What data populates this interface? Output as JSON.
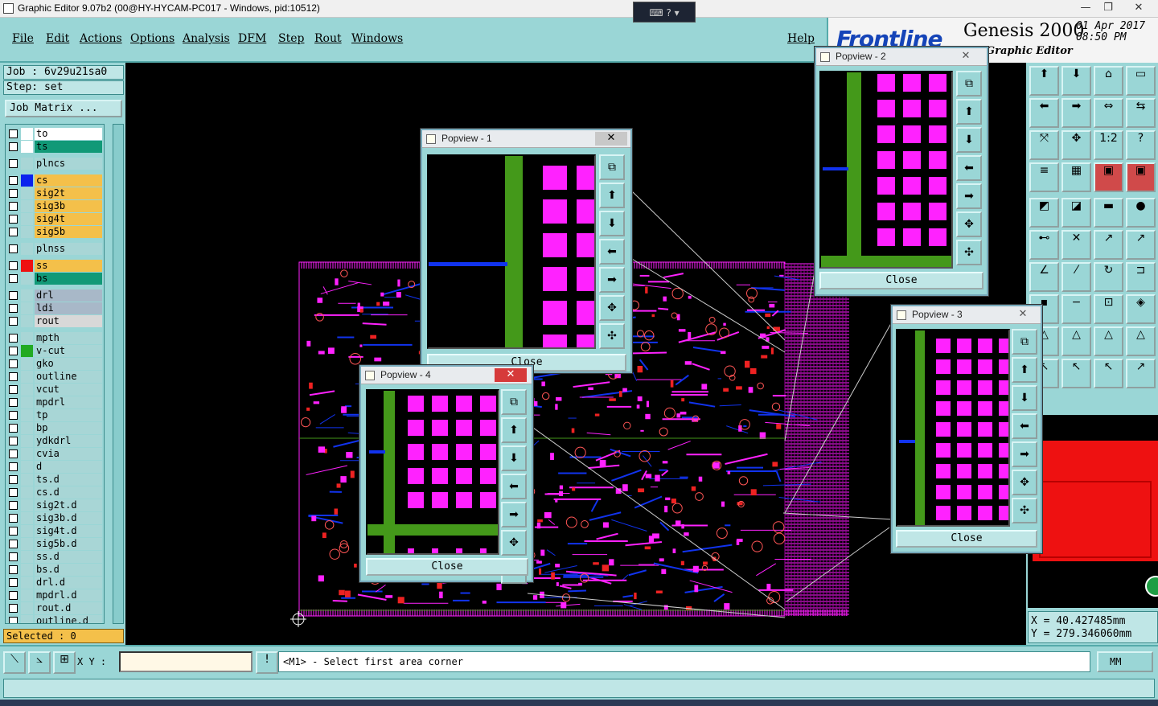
{
  "window": {
    "title": "Graphic Editor 9.07b2 (00@HY-HYCAM-PC017 - Windows, pid:10512)",
    "min": "—",
    "max": "❐",
    "close": "✕"
  },
  "ime": "⌨ ? ▾",
  "menu": [
    "File",
    "Edit",
    "Actions",
    "Options",
    "Analysis",
    "DFM",
    "Step",
    "Rout",
    "Windows"
  ],
  "help": "Help",
  "logo": {
    "brand": "Frontline",
    "product": "Genesis 2000",
    "sub": "Graphic Editor",
    "date": "01 Apr 2017",
    "time": "08:50 PM"
  },
  "job": "Job : 6v29u21sa0",
  "step": "Step: set",
  "job_matrix": "Job Matrix ...",
  "layers": [
    {
      "name": "to",
      "color": "#ffffff",
      "swatch": "#ffffff"
    },
    {
      "name": "ts",
      "color": "#119977",
      "swatch": "#ffffff"
    },
    {
      "name": "plncs",
      "color": "#a8d6d6",
      "swatch": "#a8d6d6"
    },
    {
      "name": "cs",
      "color": "#f4c04a",
      "swatch": "#0a22ee"
    },
    {
      "name": "sig2t",
      "color": "#f4c04a",
      "swatch": "#a8d6d6"
    },
    {
      "name": "sig3b",
      "color": "#f4c04a",
      "swatch": "#a8d6d6"
    },
    {
      "name": "sig4t",
      "color": "#f4c04a",
      "swatch": "#a8d6d6"
    },
    {
      "name": "sig5b",
      "color": "#f4c04a",
      "swatch": "#a8d6d6"
    },
    {
      "name": "plnss",
      "color": "#a8d6d6",
      "swatch": "#a8d6d6"
    },
    {
      "name": "ss",
      "color": "#f4c04a",
      "swatch": "#ee1111"
    },
    {
      "name": "bs",
      "color": "#119977",
      "swatch": "#a8d6d6"
    },
    {
      "name": "drl",
      "color": "#a8b8c8",
      "swatch": "#a8d6d6"
    },
    {
      "name": "ldi",
      "color": "#a8b8c8",
      "swatch": "#a8d6d6"
    },
    {
      "name": "rout",
      "color": "#d8d8d8",
      "swatch": "#a8d6d6"
    },
    {
      "name": "mpth",
      "color": "#a8d6d6",
      "swatch": "#a8d6d6"
    },
    {
      "name": "v-cut",
      "color": "#a8d6d6",
      "swatch": "#22aa22"
    },
    {
      "name": "gko",
      "color": "#a8d6d6",
      "swatch": "#a8d6d6"
    },
    {
      "name": "outline",
      "color": "#a8d6d6",
      "swatch": "#a8d6d6"
    },
    {
      "name": "vcut",
      "color": "#a8d6d6",
      "swatch": "#a8d6d6"
    },
    {
      "name": "mpdrl",
      "color": "#a8d6d6",
      "swatch": "#a8d6d6"
    },
    {
      "name": "tp",
      "color": "#a8d6d6",
      "swatch": "#a8d6d6"
    },
    {
      "name": "bp",
      "color": "#a8d6d6",
      "swatch": "#a8d6d6"
    },
    {
      "name": "ydkdrl",
      "color": "#a8d6d6",
      "swatch": "#a8d6d6"
    },
    {
      "name": "cvia",
      "color": "#a8d6d6",
      "swatch": "#a8d6d6"
    },
    {
      "name": "d",
      "color": "#a8d6d6",
      "swatch": "#a8d6d6"
    },
    {
      "name": "ts.d",
      "color": "#a8d6d6",
      "swatch": "#a8d6d6"
    },
    {
      "name": "cs.d",
      "color": "#a8d6d6",
      "swatch": "#a8d6d6"
    },
    {
      "name": "sig2t.d",
      "color": "#a8d6d6",
      "swatch": "#a8d6d6"
    },
    {
      "name": "sig3b.d",
      "color": "#a8d6d6",
      "swatch": "#a8d6d6"
    },
    {
      "name": "sig4t.d",
      "color": "#a8d6d6",
      "swatch": "#a8d6d6"
    },
    {
      "name": "sig5b.d",
      "color": "#a8d6d6",
      "swatch": "#a8d6d6"
    },
    {
      "name": "ss.d",
      "color": "#a8d6d6",
      "swatch": "#a8d6d6"
    },
    {
      "name": "bs.d",
      "color": "#a8d6d6",
      "swatch": "#a8d6d6"
    },
    {
      "name": "drl.d",
      "color": "#a8d6d6",
      "swatch": "#a8d6d6"
    },
    {
      "name": "mpdrl.d",
      "color": "#a8d6d6",
      "swatch": "#a8d6d6"
    },
    {
      "name": "rout.d",
      "color": "#a8d6d6",
      "swatch": "#a8d6d6"
    },
    {
      "name": "outline.d",
      "color": "#a8d6d6",
      "swatch": "#a8d6d6"
    }
  ],
  "selected": "Selected : 0",
  "popviews": [
    {
      "title": "Popview - 1",
      "close": "Close"
    },
    {
      "title": "Popview - 2",
      "close": "Close"
    },
    {
      "title": "Popview - 3",
      "close": "Close"
    },
    {
      "title": "Popview - 4",
      "close": "Close"
    }
  ],
  "popview_close_glyph": "✕",
  "popview_tools": [
    "⧉",
    "⬆",
    "⬇",
    "⬅",
    "➡",
    "✥",
    "✣"
  ],
  "right_tools": [
    "⬆",
    "⬇",
    "⌂",
    "▭",
    "⬅",
    "➡",
    "⇔",
    "⇆",
    "⤧",
    "✥",
    "1:2",
    "?",
    "≡",
    "▦",
    "▣",
    "▣",
    "◩",
    "◪",
    "▬",
    "●",
    "⊷",
    "✕",
    "↗",
    "↗",
    "∠",
    "⁄",
    "↻",
    "⊐",
    "▪",
    "−",
    "⊡",
    "◈",
    "△",
    "△",
    "△",
    "△",
    "↖",
    "↖",
    "↖",
    "↗"
  ],
  "coords": {
    "x": "X = 40.427485mm",
    "y": "Y = 279.346060mm"
  },
  "bottom": {
    "xy_label": "X Y :",
    "xy_value": "",
    "message": "<M1> - Select first area corner",
    "units": "MM",
    "bang": "!",
    "tools": [
      "⟍",
      "⦣",
      "⊞"
    ]
  },
  "colors": {
    "panel": "#9ad6d6",
    "canvas": "#000000",
    "copper": "#ff22ff",
    "trace": "#1133ee",
    "green": "#44991a"
  }
}
